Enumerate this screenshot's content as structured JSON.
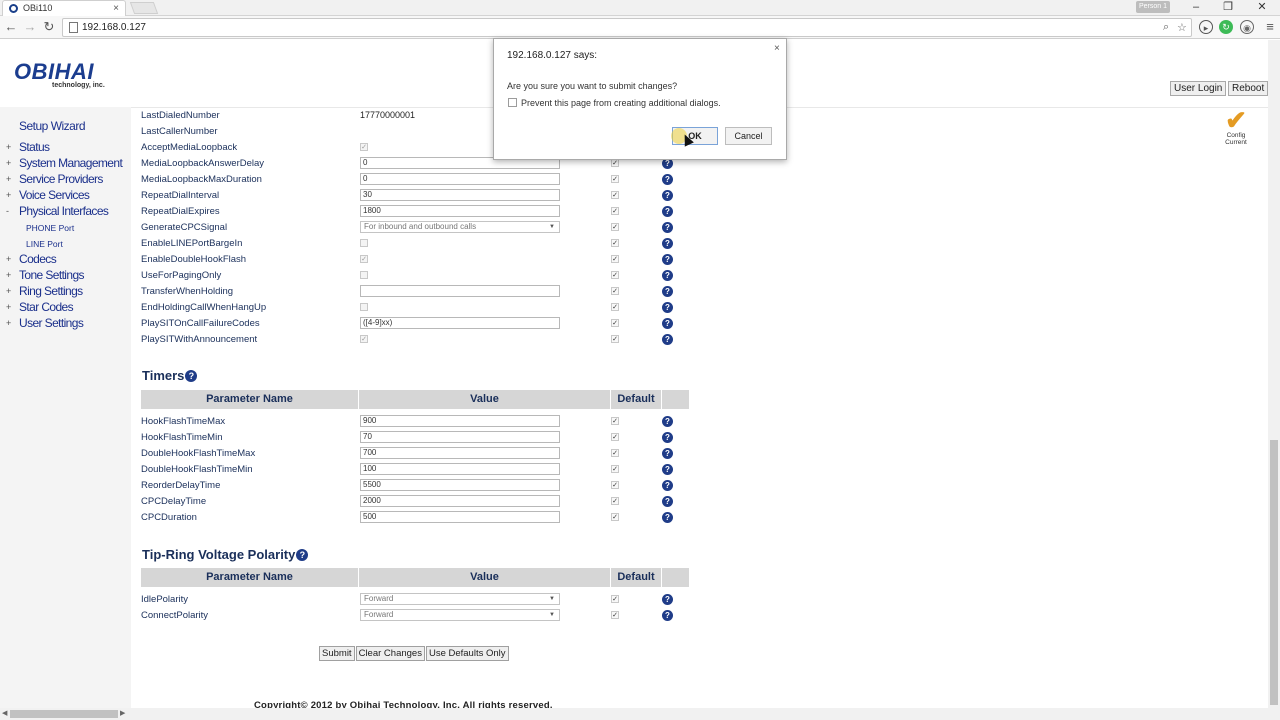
{
  "browser": {
    "tab_title": "OBi110",
    "tab_close": "×",
    "profile": "Person 1",
    "url": "192.168.0.127",
    "win_minimize": "–",
    "win_restore": "❐",
    "win_close": "✕"
  },
  "header": {
    "logo_main": "OBIHAI",
    "logo_sub": "technology, inc.",
    "user_login": "User Login",
    "reboot": "Reboot",
    "config_label_1": "Config",
    "config_label_2": "Current"
  },
  "sidebar": {
    "setup_wizard": "Setup Wizard",
    "items": [
      {
        "bullet": "+",
        "label": "Status"
      },
      {
        "bullet": "+",
        "label": "System Management"
      },
      {
        "bullet": "+",
        "label": "Service Providers"
      },
      {
        "bullet": "+",
        "label": "Voice Services"
      },
      {
        "bullet": "-",
        "label": "Physical Interfaces"
      },
      {
        "bullet": "+",
        "label": "Codecs"
      },
      {
        "bullet": "+",
        "label": "Tone Settings"
      },
      {
        "bullet": "+",
        "label": "Ring Settings"
      },
      {
        "bullet": "+",
        "label": "Star Codes"
      },
      {
        "bullet": "+",
        "label": "User Settings"
      }
    ],
    "subitems": [
      {
        "label": "PHONE Port"
      },
      {
        "label": "LINE Port"
      }
    ]
  },
  "phone_port": {
    "rows": [
      {
        "name": "LastDialedNumber",
        "value": "17770000001"
      },
      {
        "name": "LastCallerNumber",
        "value": ""
      },
      {
        "name": "AcceptMediaLoopback",
        "value": "✓"
      },
      {
        "name": "MediaLoopbackAnswerDelay",
        "value": "0"
      },
      {
        "name": "MediaLoopbackMaxDuration",
        "value": "0"
      },
      {
        "name": "RepeatDialInterval",
        "value": "30"
      },
      {
        "name": "RepeatDialExpires",
        "value": "1800"
      },
      {
        "name": "GenerateCPCSignal",
        "value": "For inbound and outbound calls"
      },
      {
        "name": "EnableLINEPortBargeIn",
        "value": ""
      },
      {
        "name": "EnableDoubleHookFlash",
        "value": "✓"
      },
      {
        "name": "UseForPagingOnly",
        "value": ""
      },
      {
        "name": "TransferWhenHolding",
        "value": ""
      },
      {
        "name": "EndHoldingCallWhenHangUp",
        "value": ""
      },
      {
        "name": "PlaySITOnCallFailureCodes",
        "value": "([4-9]xx)"
      },
      {
        "name": "PlaySITWithAnnouncement",
        "value": "✓"
      }
    ]
  },
  "timers": {
    "title": "Timers",
    "col_param": "Parameter Name",
    "col_value": "Value",
    "col_default": "Default",
    "rows": [
      {
        "name": "HookFlashTimeMax",
        "value": "900"
      },
      {
        "name": "HookFlashTimeMin",
        "value": "70"
      },
      {
        "name": "DoubleHookFlashTimeMax",
        "value": "700"
      },
      {
        "name": "DoubleHookFlashTimeMin",
        "value": "100"
      },
      {
        "name": "ReorderDelayTime",
        "value": "5500"
      },
      {
        "name": "CPCDelayTime",
        "value": "2000"
      },
      {
        "name": "CPCDuration",
        "value": "500"
      }
    ]
  },
  "polarity": {
    "title": "Tip-Ring Voltage Polarity",
    "col_param": "Parameter Name",
    "col_value": "Value",
    "col_default": "Default",
    "rows": [
      {
        "name": "IdlePolarity",
        "value": "Forward"
      },
      {
        "name": "ConnectPolarity",
        "value": "Forward"
      }
    ]
  },
  "common": {
    "help": "?",
    "check": "✓"
  },
  "actions": {
    "submit": "Submit",
    "clear": "Clear Changes",
    "defaults": "Use Defaults Only"
  },
  "footer": {
    "copyright": "Copyright© 2012 by Obihai Technology, Inc. All rights reserved."
  },
  "dialog": {
    "title": "192.168.0.127 says:",
    "close": "×",
    "message": "Are you sure you want to submit changes?",
    "prevent_label": "Prevent this page from creating additional dialogs.",
    "ok": "OK",
    "cancel": "Cancel"
  },
  "colors": {
    "nav_link": "#1a2f8b",
    "header_bg": "#d6d6d6",
    "help_icon": "#1f3c88",
    "config_check": "#e49b23"
  }
}
